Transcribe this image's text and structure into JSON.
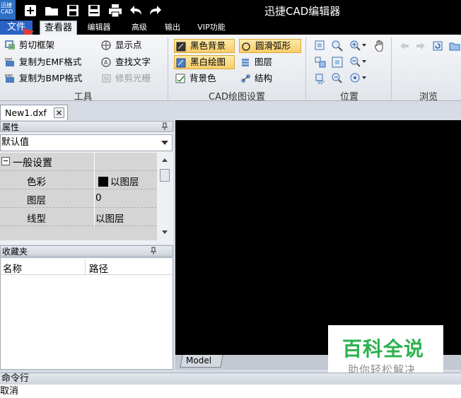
{
  "window": {
    "title": "迅捷CAD编辑器",
    "logo_text": "迅捷\nCAD"
  },
  "menu": {
    "tabs": [
      "文件",
      "查看器",
      "编辑器",
      "高级",
      "输出",
      "VIP功能"
    ]
  },
  "ribbon": {
    "tools_group": {
      "label": "工具",
      "items": [
        {
          "label": "剪切框架",
          "disabled": false
        },
        {
          "label": "复制为EMF格式",
          "disabled": false
        },
        {
          "label": "复制为BMP格式",
          "disabled": false
        },
        {
          "label": "显示点",
          "disabled": false
        },
        {
          "label": "查找文字",
          "disabled": false
        },
        {
          "label": "修剪光栅",
          "disabled": true
        }
      ]
    },
    "cad_group": {
      "label": "CAD绘图设置",
      "items": [
        {
          "label": "黑色背景",
          "selected": true
        },
        {
          "label": "黑白绘图",
          "selected": true
        },
        {
          "label": "背景色",
          "selected": false
        },
        {
          "label": "圆滑弧形",
          "selected": true
        },
        {
          "label": "图层",
          "selected": false
        },
        {
          "label": "结构",
          "selected": false
        }
      ]
    },
    "position_group": {
      "label": "位置"
    },
    "browse_group": {
      "label": "浏览"
    }
  },
  "document": {
    "tab_label": "New1.dxf"
  },
  "properties": {
    "header": "属性",
    "selector_value": "默认值",
    "section_title": "一般设置",
    "rows": [
      {
        "name": "色彩",
        "value": "以图层"
      },
      {
        "name": "图层",
        "value": "0"
      },
      {
        "name": "线型",
        "value": "以图层"
      }
    ]
  },
  "favorites": {
    "header": "收藏夹",
    "columns": [
      "名称",
      "路径"
    ]
  },
  "canvas": {
    "layout_tab": "Model",
    "background": "#000000"
  },
  "watermark": {
    "title": "百科全说",
    "subtitle": "助你轻松解决"
  },
  "command": {
    "header": "命令行",
    "output": "取消"
  },
  "colors": {
    "accent": "#2b62c7",
    "selected_fill": "#f8cd6a",
    "watermark_green": "#2bb24c"
  }
}
